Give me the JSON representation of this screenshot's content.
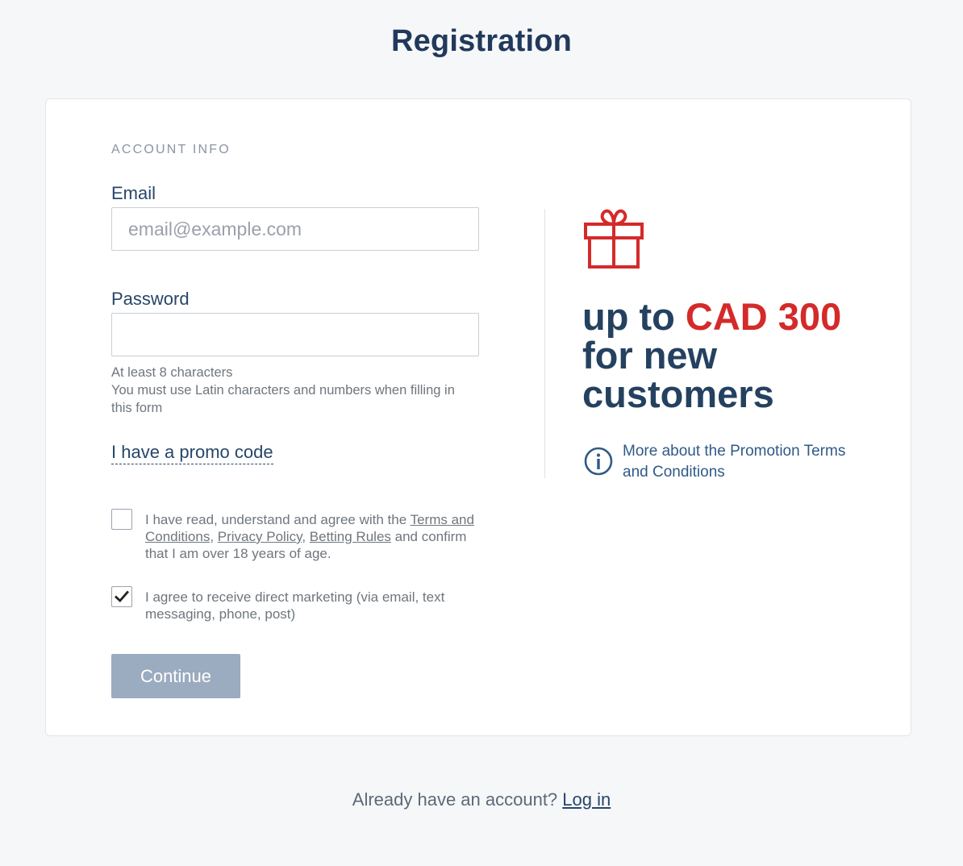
{
  "page": {
    "title": "Registration"
  },
  "form": {
    "section_heading": "ACCOUNT INFO",
    "email": {
      "label": "Email",
      "placeholder": "email@example.com",
      "value": ""
    },
    "password": {
      "label": "Password",
      "value": "",
      "hint_line1": "At least 8 characters",
      "hint_line2": "You must use Latin characters and numbers when filling in this form"
    },
    "promo_link": "I have a promo code",
    "terms_checkbox": {
      "checked": false,
      "text_before": "I have read, understand and agree with the ",
      "terms_link": "Terms and Conditions",
      "sep1": ", ",
      "privacy_link": "Privacy Policy",
      "sep2": ", ",
      "betting_link": "Betting Rules",
      "text_after": " and confirm that I am over 18 years of age."
    },
    "marketing_checkbox": {
      "checked": true,
      "text": "I agree to receive direct marketing (via email, text messaging, phone, post)"
    },
    "continue_button": "Continue"
  },
  "promo": {
    "icon": "gift-icon",
    "headline_prefix": "up to ",
    "amount": "CAD 300",
    "headline_suffix": " for new customers",
    "info_icon": "info-icon",
    "more_link": "More about the Promotion Terms and Conditions",
    "colors": {
      "accent_red": "#d42a2a",
      "heading_navy": "#24415f"
    }
  },
  "footer": {
    "prompt": "Already have an account? ",
    "login_link": "Log in"
  },
  "colors": {
    "background": "#f6f7f9",
    "button_disabled": "#9babc0"
  }
}
